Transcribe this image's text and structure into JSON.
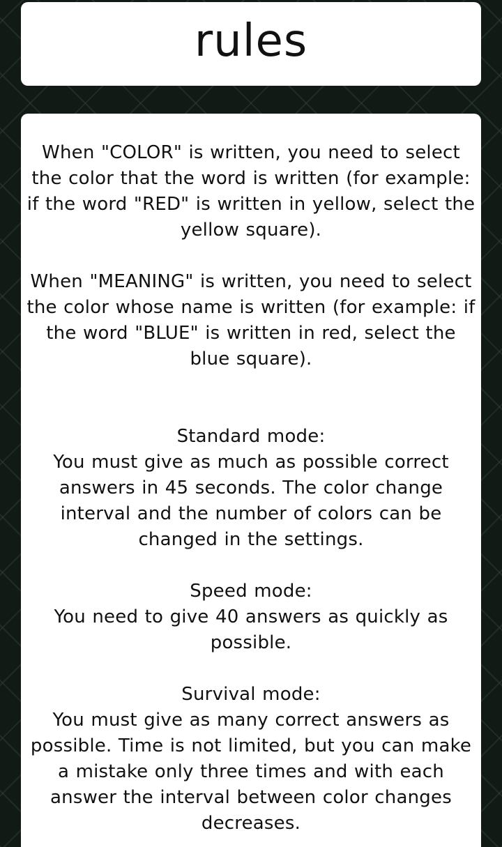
{
  "header": {
    "title": "rules"
  },
  "rules": {
    "color_rule": "When \"COLOR\" is written, you need to select the color that the word is written (for example: if the word \"RED\" is written in yellow, select the yellow square).",
    "meaning_rule": "When \"MEANING\" is written, you need to select the color whose name is written (for example: if the word \"BLUE\" is written in red, select the blue square).",
    "modes": [
      {
        "title": "Standard mode:",
        "description": "You must give as much as possible correct answers in 45 seconds. The color change interval and the number of colors can be changed in the settings."
      },
      {
        "title": "Speed mode:",
        "description": "You need to give 40 answers as quickly as possible."
      },
      {
        "title": "Survival mode:",
        "description": "You must give as many correct answers as possible. Time is not limited, but you can make a mistake only three times and with each answer the interval between color changes decreases."
      }
    ]
  },
  "colors": {
    "background": "#121a16",
    "card": "#ffffff",
    "text": "#111111"
  }
}
